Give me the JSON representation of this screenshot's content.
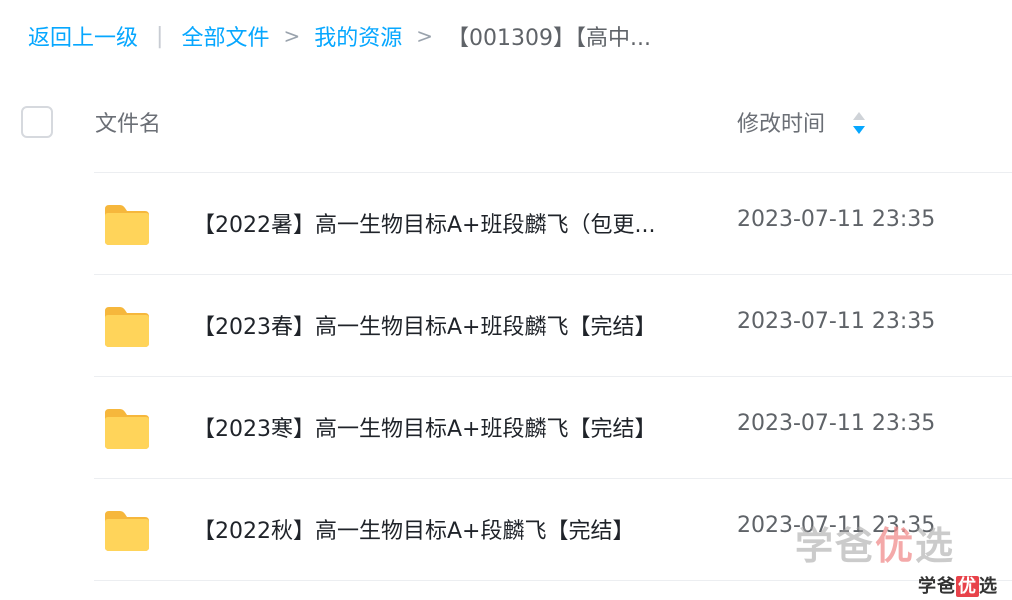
{
  "breadcrumb": {
    "back_label": "返回上一级",
    "separator": "|",
    "chevron": ">",
    "all_files": "全部文件",
    "my_resources": "我的资源",
    "current": "【001309】【高中..."
  },
  "table": {
    "col_name": "文件名",
    "col_time": "修改时间",
    "rows": [
      {
        "name": "【2022暑】高一生物目标A+班段麟飞（包更...",
        "time": "2023-07-11 23:35"
      },
      {
        "name": "【2023春】高一生物目标A+班段麟飞【完结】",
        "time": "2023-07-11 23:35"
      },
      {
        "name": "【2023寒】高一生物目标A+班段麟飞【完结】",
        "time": "2023-07-11 23:35"
      },
      {
        "name": "【2022秋】高一生物目标A+段麟飞【完结】",
        "time": "2023-07-11 23:35"
      }
    ]
  },
  "icons": {
    "folder": "folder-icon",
    "sort": "sort-icon",
    "checkbox": "checkbox"
  },
  "colors": {
    "link": "#06a7ff",
    "folder": "#ffc83d",
    "sort_active": "#06a7ff"
  },
  "watermark": {
    "large_part1": "学爸",
    "large_part2": "优",
    "large_part3": "选",
    "small_part1": "学爸",
    "small_part2": "优",
    "small_part3": "选"
  }
}
